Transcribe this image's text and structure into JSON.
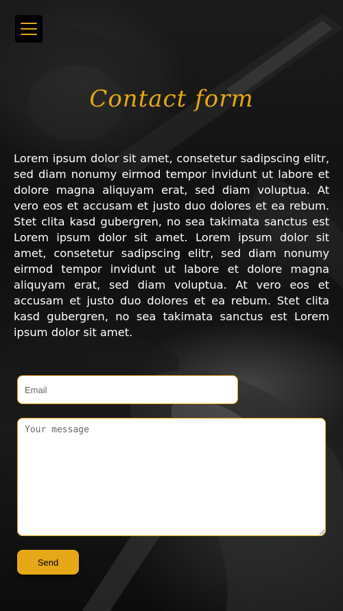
{
  "header": {
    "menu_icon": "hamburger-icon"
  },
  "page": {
    "title": "Contact form",
    "body": "Lorem ipsum dolor sit amet, consetetur sadipscing elitr, sed diam nonumy eirmod tempor invidunt ut labore et dolore magna aliquyam erat, sed diam voluptua. At vero eos et accusam et justo duo dolores et ea rebum. Stet clita kasd gubergren, no sea takimata sanctus est Lorem ipsum dolor sit amet. Lorem ipsum dolor sit amet, consetetur sadipscing elitr, sed diam nonumy eirmod tempor invidunt ut labore et dolore magna aliquyam erat, sed diam voluptua. At vero eos et accusam et justo duo dolores et ea rebum. Stet clita kasd gubergren, no sea takimata sanctus est Lorem ipsum dolor sit amet."
  },
  "form": {
    "email_placeholder": "Email",
    "email_value": "",
    "message_placeholder": "Your message",
    "message_value": "",
    "send_label": "Send"
  },
  "colors": {
    "accent": "#e6a817",
    "background": "#111111",
    "text": "#ffffff"
  }
}
